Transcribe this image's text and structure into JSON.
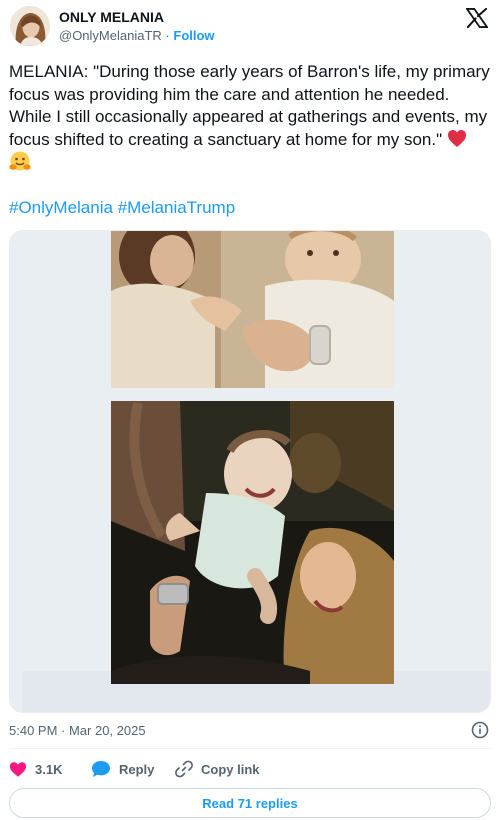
{
  "author": {
    "display_name": "ONLY MELANIA",
    "handle": "@OnlyMelaniaTR",
    "separator": "·",
    "follow_label": "Follow"
  },
  "tweet": {
    "text": "MELANIA: \"During those early years of Barron's life, my primary focus was providing him the care and attention he needed. While I still occasionally appeared at gatherings and events, my focus shifted to creating a sanctuary at home for my son.\"",
    "emojis": [
      "red-heart",
      "hugging-face"
    ],
    "hashtags": [
      "#OnlyMelania",
      "#MelaniaTrump"
    ],
    "timestamp": "5:40 PM · Mar 20, 2025"
  },
  "actions": {
    "like_count": "3.1K",
    "reply_label": "Reply",
    "copy_label": "Copy link"
  },
  "footer": {
    "read_replies_label": "Read 71 replies"
  },
  "colors": {
    "accent": "#1d9bf0",
    "text": "#0f1419",
    "muted": "#536471",
    "like": "#f91880"
  },
  "icons": [
    "x-logo-icon",
    "info-icon",
    "heart-icon",
    "reply-bubble-icon",
    "link-icon"
  ]
}
